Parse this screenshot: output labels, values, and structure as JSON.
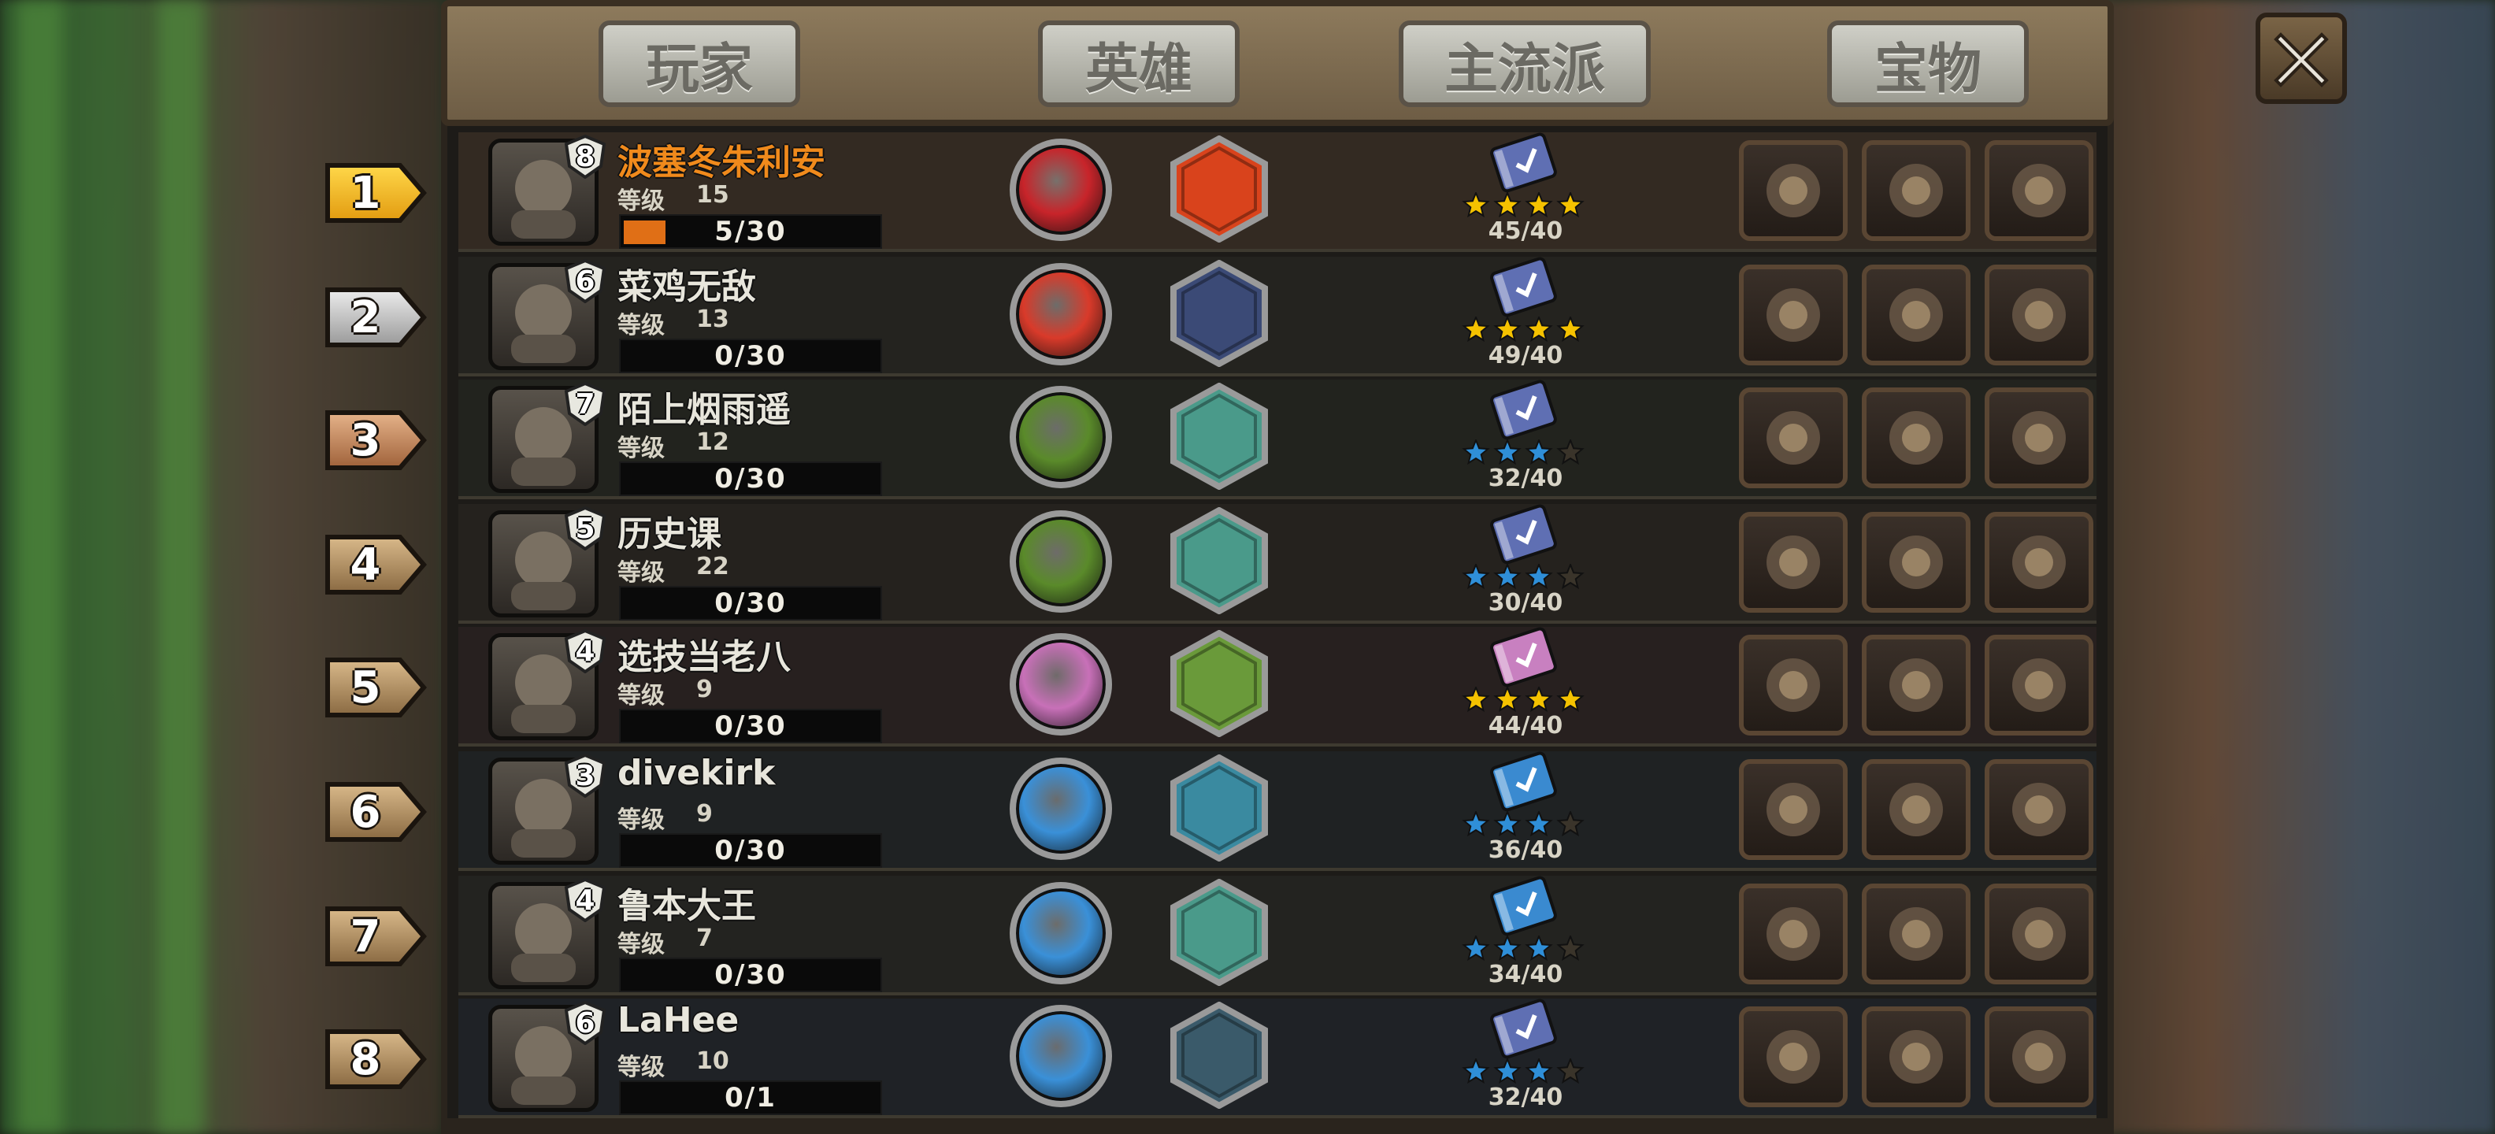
{
  "tabs": [
    {
      "label": "玩家"
    },
    {
      "label": "英雄"
    },
    {
      "label": "主流派"
    },
    {
      "label": "宝物"
    }
  ],
  "level_label": "等级",
  "colors": {
    "highlight_name": "#f08a1c",
    "normal_name": "#e8e6dc",
    "gold_star": "#f5c200",
    "blue_star": "#2f8fd8"
  },
  "players": [
    {
      "rank": "1",
      "name": "波塞冬朱利安",
      "avatar_level": "8",
      "level": "15",
      "progress": "5/30",
      "progress_fraction": 0.1667,
      "score": "45/40",
      "stars": "gold",
      "highlight": true,
      "hero_icon": "axe-icon",
      "hero_color": "#c8242a",
      "faction_icon": "bomb-icon",
      "faction_color": "#d9431c",
      "book_color": "#5f6fb3",
      "items": [
        "compass-icon",
        "potion-icon",
        "ring-icon"
      ]
    },
    {
      "rank": "2",
      "name": "菜鸡无敌",
      "avatar_level": "6",
      "level": "13",
      "progress": "0/30",
      "progress_fraction": 0,
      "score": "49/40",
      "stars": "gold",
      "highlight": false,
      "hero_icon": "boot-icon",
      "hero_color": "#d93a2a",
      "faction_icon": "tornado-icon",
      "faction_color": "#3b4a76",
      "book_color": "#5f6fb3",
      "items": [
        "potion-icon",
        "hat-icon",
        "flask-icon"
      ]
    },
    {
      "rank": "3",
      "name": "陌上烟雨遥",
      "avatar_level": "7",
      "level": "12",
      "progress": "0/30",
      "progress_fraction": 0,
      "score": "32/40",
      "stars": "blue",
      "highlight": false,
      "hero_icon": "nature-orb-icon",
      "hero_color": "#5a8a2a",
      "faction_icon": "wind-icon",
      "faction_color": "#4a9a8a",
      "book_color": "#5f6fb3",
      "items": [
        "spear-icon",
        "armor-icon",
        "shield-icon"
      ]
    },
    {
      "rank": "4",
      "name": "历史课",
      "avatar_level": "5",
      "level": "22",
      "progress": "0/30",
      "progress_fraction": 0,
      "score": "30/40",
      "stars": "blue",
      "highlight": false,
      "hero_icon": "nature-orb-icon",
      "hero_color": "#5a8a2a",
      "faction_icon": "wind-icon",
      "faction_color": "#4a9a8a",
      "book_color": "#5f6fb3",
      "items": [
        "gift-icon",
        "gear-icon",
        "gift-icon"
      ]
    },
    {
      "rank": "5",
      "name": "选技当老八",
      "avatar_level": "4",
      "level": "9",
      "progress": "0/30",
      "progress_fraction": 0,
      "score": "44/40",
      "stars": "gold",
      "highlight": false,
      "hero_icon": "pink-orb-icon",
      "hero_color": "#c870b8",
      "faction_icon": "vine-icon",
      "faction_color": "#6a9a3a",
      "book_color": "#c880c0",
      "items": [
        "bench-icon",
        "gauntlet-icon",
        "staff-icon"
      ]
    },
    {
      "rank": "6",
      "name": "divekirk",
      "avatar_level": "3",
      "level": "9",
      "progress": "0/30",
      "progress_fraction": 0,
      "score": "36/40",
      "stars": "blue",
      "highlight": false,
      "hero_icon": "heart-orb-icon",
      "hero_color": "#3a90d8",
      "faction_icon": "ice-icon",
      "faction_color": "#3a8aa0",
      "book_color": "#3a8ad0",
      "items": [
        "medallion-icon",
        "dragon-icon",
        "spellbook-icon"
      ]
    },
    {
      "rank": "7",
      "name": "鲁本大王",
      "avatar_level": "4",
      "level": "7",
      "progress": "0/30",
      "progress_fraction": 0,
      "score": "34/40",
      "stars": "blue",
      "highlight": false,
      "hero_icon": "heart-orb-icon",
      "hero_color": "#3a90d8",
      "faction_icon": "wind-icon",
      "faction_color": "#4a9a8a",
      "book_color": "#3a8ad0",
      "items": [
        "staff-icon",
        "scales-icon",
        "tome-icon"
      ]
    },
    {
      "rank": "8",
      "name": "LaHee",
      "avatar_level": "6",
      "level": "10",
      "progress": "0/1",
      "progress_fraction": 0,
      "score": "32/40",
      "stars": "blue",
      "highlight": false,
      "hero_icon": "lightning-orb-icon",
      "hero_color": "#3a90d8",
      "faction_icon": "dragon-head-icon",
      "faction_color": "#3a5a6a",
      "book_color": "#5f6fb3",
      "items": [
        "rose-icon",
        "tome-icon",
        "sword-icon"
      ]
    }
  ]
}
